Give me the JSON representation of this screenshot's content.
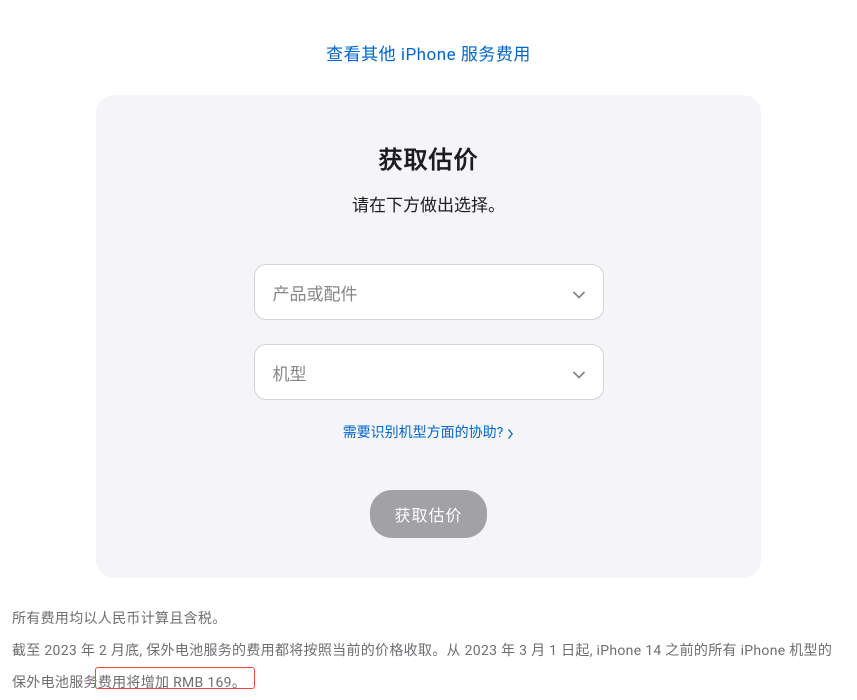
{
  "topLink": {
    "label": "查看其他 iPhone 服务费用"
  },
  "card": {
    "title": "获取估价",
    "subtitle": "请在下方做出选择。",
    "select1": {
      "placeholder": "产品或配件"
    },
    "select2": {
      "placeholder": "机型"
    },
    "helpLink": "需要识别机型方面的协助?",
    "button": "获取估价"
  },
  "footer": {
    "line1": "所有费用均以人民币计算且含税。",
    "line2_part1": "截至 2023 年 2 月底, 保外电池服务的费用都将按照当前的价格收取。从 2023 年 3 月 1 日起, iPhone 14 之前的所有 iPhone 机型的保外电池服务",
    "line2_part2": "费用将增加 RMB 169。"
  }
}
